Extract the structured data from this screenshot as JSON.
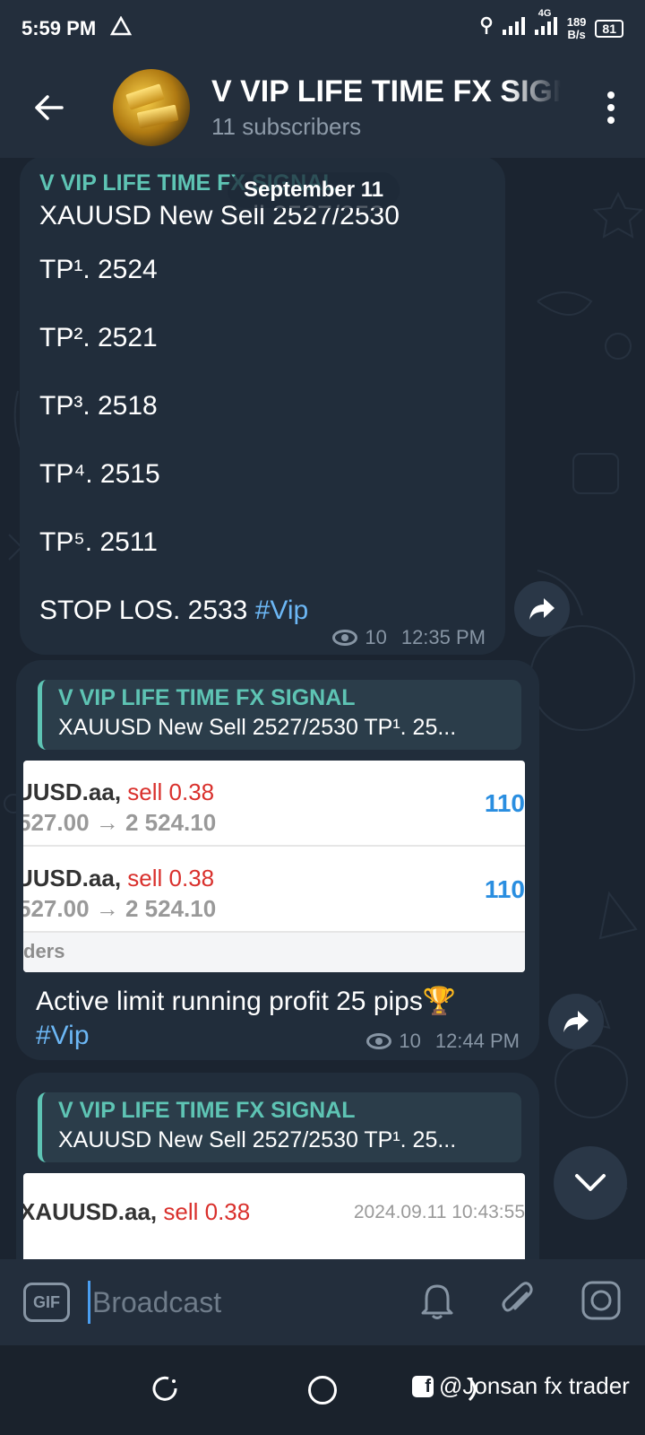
{
  "status_bar": {
    "time": "5:59 PM",
    "network": "4G",
    "speed_value": "189",
    "speed_unit": "B/s",
    "battery": "81"
  },
  "header": {
    "title": "V VIP LIFE TIME FX SIGNAL",
    "subtitle": "11 subscribers"
  },
  "date_pill": "September 11",
  "messages": [
    {
      "author": "V VIP LIFE TIME FX SIGNAL",
      "lines": [
        "XAUUSD New Sell 2527/2530",
        "TP¹. 2524",
        "TP². 2521",
        "TP³. 2518",
        "TP⁴. 2515",
        "TP⁵. 2511"
      ],
      "last_line": "STOP LOS. 2533",
      "hashtag": "#Vip",
      "views": "10",
      "time": "12:35 PM"
    },
    {
      "reply_author": "V VIP LIFE TIME FX SIGNAL",
      "reply_text": "XAUUSD New Sell 2527/2530  TP¹. 25...",
      "screenshot_rows": [
        {
          "symbol": "UUSD.aa,",
          "action": "sell 0.38",
          "prices": "527.00 →  2 524.10",
          "profit": "110"
        },
        {
          "symbol": "UUSD.aa,",
          "action": "sell 0.38",
          "prices": "527.00 →  2 524.10",
          "profit": "110"
        }
      ],
      "screenshot_footer": "ders",
      "caption": "Active limit running profit 25 pips🏆",
      "hashtag": "#Vip",
      "views": "10",
      "time": "12:44 PM"
    },
    {
      "reply_author": "V VIP LIFE TIME FX SIGNAL",
      "reply_text": "XAUUSD New Sell 2527/2530  TP¹. 25...",
      "screenshot_symbol": "XAUUSD.aa,",
      "screenshot_action": "sell 0.38",
      "screenshot_date": "2024.09.11 10:43:55"
    }
  ],
  "input": {
    "gif_label": "GIF",
    "placeholder": "Broadcast"
  },
  "watermark": "@Jonsan fx trader",
  "colors": {
    "background": "#1b2430",
    "bubble": "#212d3b",
    "header": "#232e3c",
    "accent_name": "#5ec4b4",
    "hashtag": "#6cb7f5",
    "sell_red": "#d9302c",
    "profit_blue": "#2a8ee0"
  }
}
